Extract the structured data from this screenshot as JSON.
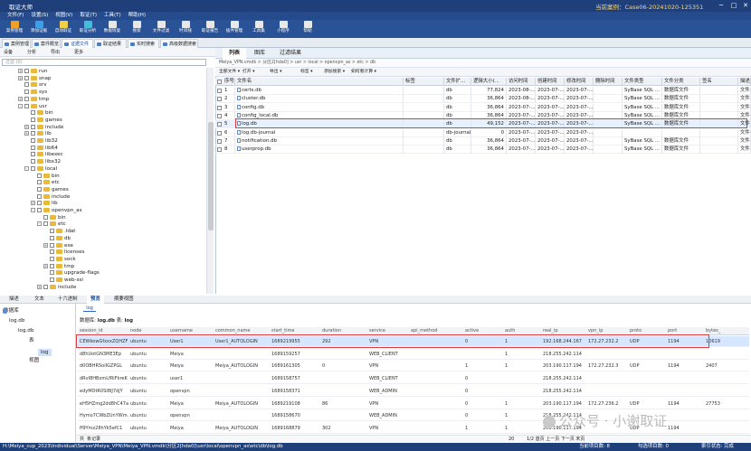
{
  "app": {
    "title": "取证大师",
    "case": "当前案例：Case06-20241020-125351"
  },
  "menu": [
    "文件(F)",
    "设置(S)",
    "视图(V)",
    "取证(T)",
    "工具(T)",
    "帮助(H)"
  ],
  "ribbon": [
    {
      "label": "案例管理",
      "color": "#f0a028"
    },
    {
      "label": "添加证据",
      "color": "#3aa0e8"
    },
    {
      "label": "自动取证",
      "color": "#f0d048"
    },
    {
      "label": "取证分析",
      "color": "#40c0d8"
    },
    {
      "label": "数据恢复",
      "color": "#e8e8e8"
    },
    {
      "label": "搜索",
      "color": "#e8e8e8"
    },
    {
      "label": "文件过滤",
      "color": "#e8e8e8"
    },
    {
      "label": "时间线",
      "color": "#e8e8e8"
    },
    {
      "label": "取证报告",
      "color": "#e8e8e8"
    },
    {
      "label": "插件管理",
      "color": "#e8e8e8"
    },
    {
      "label": "工具集",
      "color": "#e8e8e8"
    },
    {
      "label": "小程序",
      "color": "#e8e8e8"
    },
    {
      "label": "帮助",
      "color": "#e8e8e8"
    }
  ],
  "tabs": [
    "案例管理",
    "案件概览",
    "证据文件",
    "取证结果",
    "实时搜索",
    "高级数据搜索"
  ],
  "left_toolbar": [
    "设备",
    "分析",
    "导出",
    "更多"
  ],
  "left_filter_placeholder": "过滤 (0)",
  "tree": [
    {
      "label": "run",
      "lvl": 3,
      "pm": "+"
    },
    {
      "label": "snap",
      "lvl": 3,
      "pm": "+"
    },
    {
      "label": "srv",
      "lvl": 3,
      "pm": ""
    },
    {
      "label": "sys",
      "lvl": 3,
      "pm": ""
    },
    {
      "label": "tmp",
      "lvl": 3,
      "pm": "+"
    },
    {
      "label": "usr",
      "lvl": 3,
      "pm": "-"
    },
    {
      "label": "bin",
      "lvl": 4,
      "pm": ""
    },
    {
      "label": "games",
      "lvl": 4,
      "pm": ""
    },
    {
      "label": "include",
      "lvl": 4,
      "pm": "+"
    },
    {
      "label": "lib",
      "lvl": 4,
      "pm": "+"
    },
    {
      "label": "lib32",
      "lvl": 4,
      "pm": ""
    },
    {
      "label": "lib64",
      "lvl": 4,
      "pm": ""
    },
    {
      "label": "libexec",
      "lvl": 4,
      "pm": ""
    },
    {
      "label": "libx32",
      "lvl": 4,
      "pm": ""
    },
    {
      "label": "local",
      "lvl": 4,
      "pm": "-"
    },
    {
      "label": "bin",
      "lvl": 5,
      "pm": ""
    },
    {
      "label": "etc",
      "lvl": 5,
      "pm": ""
    },
    {
      "label": "games",
      "lvl": 5,
      "pm": ""
    },
    {
      "label": "include",
      "lvl": 5,
      "pm": ""
    },
    {
      "label": "lib",
      "lvl": 5,
      "pm": "+"
    },
    {
      "label": "openvpn_as",
      "lvl": 5,
      "pm": "-"
    },
    {
      "label": "bin",
      "lvl": 6,
      "pm": ""
    },
    {
      "label": "etc",
      "lvl": 6,
      "pm": "-"
    },
    {
      "label": ".ldat",
      "lvl": 7,
      "pm": ""
    },
    {
      "label": "db",
      "lvl": 7,
      "pm": ""
    },
    {
      "label": "exe",
      "lvl": 7,
      "pm": "+"
    },
    {
      "label": "licenses",
      "lvl": 7,
      "pm": ""
    },
    {
      "label": "sock",
      "lvl": 7,
      "pm": ""
    },
    {
      "label": "tmp",
      "lvl": 7,
      "pm": "+"
    },
    {
      "label": "upgrade-flags",
      "lvl": 7,
      "pm": ""
    },
    {
      "label": "web-ssl",
      "lvl": 7,
      "pm": ""
    },
    {
      "label": "include",
      "lvl": 6,
      "pm": "+"
    }
  ],
  "left_bottom_tabs": [
    "描述",
    "文本",
    "十六进制",
    "预览",
    "摘要视图"
  ],
  "right_tabs": [
    "列表",
    "图库",
    "过滤结果"
  ],
  "breadcrumb": "Meiya_VPN.vmdk > 分区2[hda0] > usr > local > openvpn_as > etc > db",
  "right_toolbar": [
    "全部文件 ▾",
    "打开 ▾",
    "导出 ▾",
    "标签 ▾",
    "添加搜索 ▾",
    "如何看计算 ▾"
  ],
  "file_columns": [
    "序号",
    "文件名",
    "标签",
    "文件扩...",
    "逻辑大小(...",
    "访问时间",
    "创建时间",
    "修改时间",
    "删除时间",
    "文件类型",
    "文件分类",
    "签名",
    "描述"
  ],
  "files": [
    {
      "n": "1",
      "name": "certs.db",
      "ext": "db",
      "size": "77,824",
      "atime": "2023-08-...",
      "ctime": "2023-07-...",
      "mtime": "2023-07-...",
      "dtime": "",
      "type": "SyBase SQL ...",
      "cat": "数据库文件",
      "sig": "",
      "desc": "文件"
    },
    {
      "n": "2",
      "name": "cluster.db",
      "ext": "db",
      "size": "36,864",
      "atime": "2023-08-...",
      "ctime": "2023-07-...",
      "mtime": "2023-07-...",
      "dtime": "",
      "type": "SyBase SQL ...",
      "cat": "数据库文件",
      "sig": "",
      "desc": "文件"
    },
    {
      "n": "3",
      "name": "config.db",
      "ext": "db",
      "size": "36,864",
      "atime": "2023-07-...",
      "ctime": "2023-07-...",
      "mtime": "2023-07-...",
      "dtime": "",
      "type": "SyBase SQL ...",
      "cat": "数据库文件",
      "sig": "",
      "desc": "文件"
    },
    {
      "n": "4",
      "name": "config_local.db",
      "ext": "db",
      "size": "36,864",
      "atime": "2023-07-...",
      "ctime": "2023-07-...",
      "mtime": "2023-07-...",
      "dtime": "",
      "type": "SyBase SQL ...",
      "cat": "数据库文件",
      "sig": "",
      "desc": "文件"
    },
    {
      "n": "5",
      "name": "log.db",
      "ext": "db",
      "size": "49,152",
      "atime": "2023-07-...",
      "ctime": "2023-07-...",
      "mtime": "2023-07-...",
      "dtime": "",
      "type": "SyBase SQL ...",
      "cat": "数据库文件",
      "sig": "",
      "desc": "文件"
    },
    {
      "n": "6",
      "name": "log.db-journal",
      "ext": "db-journal",
      "size": "0",
      "atime": "2023-07-...",
      "ctime": "2023-07-...",
      "mtime": "2023-07-...",
      "dtime": "",
      "type": "",
      "cat": "",
      "sig": "",
      "desc": "文件"
    },
    {
      "n": "7",
      "name": "notification.db",
      "ext": "db",
      "size": "36,864",
      "atime": "2023-07-...",
      "ctime": "2023-07-...",
      "mtime": "2023-07-...",
      "dtime": "",
      "type": "SyBase SQL ...",
      "cat": "数据库文件",
      "sig": "",
      "desc": "文件"
    },
    {
      "n": "8",
      "name": "userprop.db",
      "ext": "db",
      "size": "36,864",
      "atime": "2023-07-...",
      "ctime": "2023-07-...",
      "mtime": "2023-07-...",
      "dtime": "",
      "type": "SyBase SQL ...",
      "cat": "数据库文件",
      "sig": "",
      "desc": "文件"
    }
  ],
  "db_panel": {
    "title": "数据库",
    "file": "log.db",
    "node": "log.db",
    "sub": "表",
    "table": "log",
    "schema": "视图"
  },
  "db_tab": "log",
  "db_info": {
    "label": "数据库:",
    "db": "log.db",
    "table_label": "表:",
    "table": "log"
  },
  "log_columns": [
    "session_id",
    "node",
    "username",
    "common_name",
    "start_time",
    "duration",
    "service",
    "api_method",
    "active",
    "auth",
    "real_ip",
    "vpn_ip",
    "proto",
    "port",
    "bytes_"
  ],
  "log_rows": [
    [
      "CEWkowGfxxxZQHZF",
      "ubuntu",
      "User1",
      "User1_AUTOLOGIN",
      "1689219955",
      "292",
      "VPN",
      "",
      "0",
      "1",
      "192.168.244.167",
      "172.27.232.2",
      "UDP",
      "1194",
      "10619"
    ],
    [
      "d8hUotGN3ME3Ep",
      "ubuntu",
      "Meiya",
      "",
      "1689159257",
      "",
      "WEB_CLIENT",
      "",
      "",
      "1",
      "218.255.242.114",
      "",
      "",
      "",
      ""
    ],
    [
      "d0OBHRSoiIGZPGL",
      "ubuntu",
      "Meiya",
      "Meiya_AUTOLOGIN",
      "1689161305",
      "0",
      "VPN",
      "",
      "1",
      "1",
      "203.190.117.194",
      "172.27.232.3",
      "UDP",
      "1194",
      "2407"
    ],
    [
      "dRvI8HBxmLfRiFkreK",
      "ubuntu",
      "user1",
      "",
      "1689158757",
      "",
      "WEB_CLIENT",
      "",
      "0",
      "",
      "218.255.242.114",
      "",
      "",
      "",
      ""
    ],
    [
      "edyMOtR0SI8IJ7djY",
      "ubuntu",
      "openvpn",
      "",
      "1689158371",
      "",
      "WEB_ADMIN",
      "",
      "0",
      "",
      "218.255.242.114",
      "",
      "",
      "",
      ""
    ],
    [
      "eH5HZmg2dd8hC47a",
      "ubuntu",
      "Meiya",
      "Meiya_AUTOLOGIN",
      "1689219108",
      "86",
      "VPN",
      "",
      "0",
      "1",
      "203.190.117.194",
      "172.27.236.2",
      "UDP",
      "1194",
      "27753"
    ],
    [
      "Hymo7CWbZUnYWm...",
      "ubuntu",
      "openvpn",
      "",
      "1689158670",
      "",
      "WEB_ADMIN",
      "",
      "0",
      "1",
      "218.255.242.114",
      "",
      "",
      "",
      ""
    ],
    [
      "ff9Ymz28hYk5efC1",
      "ubuntu",
      "Meiya",
      "Meiya_AUTOLOGIN",
      "1689168879",
      "302",
      "VPN",
      "",
      "1",
      "1",
      "203.190.117.194",
      "",
      "UDP",
      "1194",
      ""
    ]
  ],
  "db_foot": {
    "count": "共",
    "label": "条记录",
    "page": "20",
    "pager": "1/2 首页 上一页 下一页 末页"
  },
  "status": {
    "path": "H:\\Meiya_cup_2023\\Individual\\Server\\Meiya_VPN\\Meiya_VPN.vmdk\\分区2[hda0]\\usr\\local\\openvpn_as\\etc\\db\\log.db",
    "items": "当前项目数: 8",
    "checked": "勾选项目数: 0",
    "sync": "索引状态: 完成"
  },
  "watermark": "公众号 · 小谢取证"
}
